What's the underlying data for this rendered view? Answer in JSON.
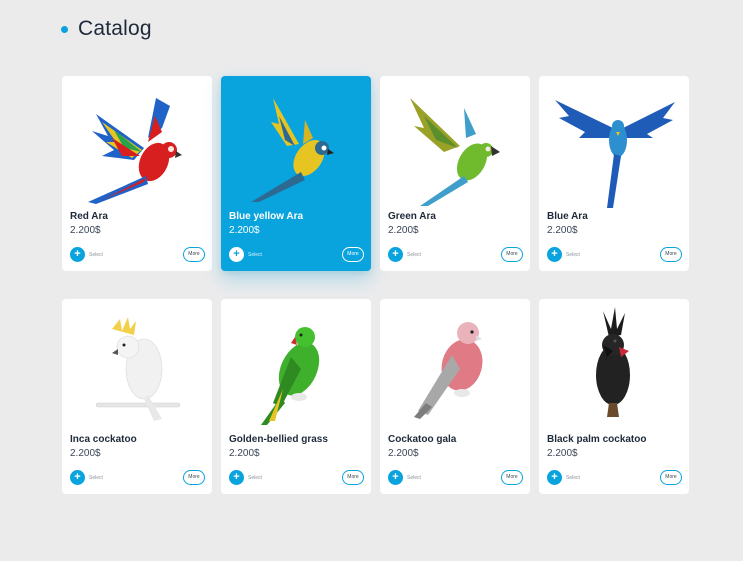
{
  "header": {
    "title": "Catalog"
  },
  "products": [
    {
      "name": "Red Ara",
      "price": "2.200$",
      "select_label": "Select",
      "more_label": "More",
      "active": false,
      "bird": "red-ara"
    },
    {
      "name": "Blue yellow Ara",
      "price": "2.200$",
      "select_label": "Select",
      "more_label": "More",
      "active": true,
      "bird": "blue-yellow-ara"
    },
    {
      "name": "Green Ara",
      "price": "2.200$",
      "select_label": "Select",
      "more_label": "More",
      "active": false,
      "bird": "green-ara"
    },
    {
      "name": "Blue Ara",
      "price": "2.200$",
      "select_label": "Select",
      "more_label": "More",
      "active": false,
      "bird": "blue-ara"
    },
    {
      "name": "Inca cockatoo",
      "price": "2.200$",
      "select_label": "Select",
      "more_label": "More",
      "active": false,
      "bird": "inca-cockatoo"
    },
    {
      "name": "Golden-bellied grass",
      "price": "2.200$",
      "select_label": "Select",
      "more_label": "More",
      "active": false,
      "bird": "golden-bellied-grass"
    },
    {
      "name": "Cockatoo gala",
      "price": "2.200$",
      "select_label": "Select",
      "more_label": "More",
      "active": false,
      "bird": "cockatoo-gala"
    },
    {
      "name": "Black palm cockatoo",
      "price": "2.200$",
      "select_label": "Select",
      "more_label": "More",
      "active": false,
      "bird": "black-palm-cockatoo"
    }
  ],
  "colors": {
    "accent": "#09a4de",
    "background": "#ebebec",
    "card": "#ffffff",
    "text": "#1e2a3a"
  }
}
